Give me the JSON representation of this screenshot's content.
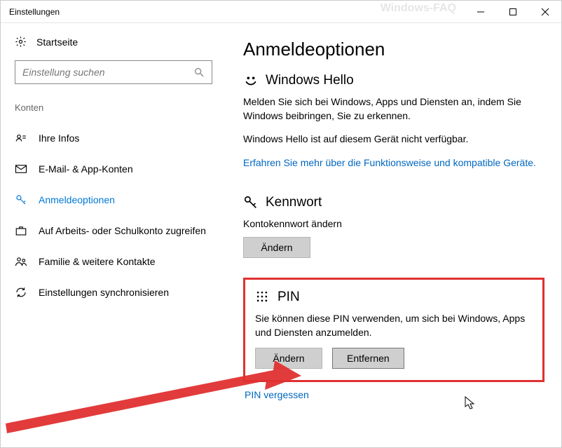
{
  "window": {
    "title": "Einstellungen",
    "watermark": "Windows-FAQ"
  },
  "sidebar": {
    "home_label": "Startseite",
    "search_placeholder": "Einstellung suchen",
    "section_label": "Konten",
    "items": [
      {
        "label": "Ihre Infos"
      },
      {
        "label": "E-Mail- & App-Konten"
      },
      {
        "label": "Anmeldeoptionen"
      },
      {
        "label": "Auf Arbeits- oder Schulkonto zugreifen"
      },
      {
        "label": "Familie & weitere Kontakte"
      },
      {
        "label": "Einstellungen synchronisieren"
      }
    ]
  },
  "main": {
    "title": "Anmeldeoptionen",
    "hello": {
      "heading": "Windows Hello",
      "desc": "Melden Sie sich bei Windows, Apps und Diensten an, indem Sie Windows beibringen, Sie zu erkennen.",
      "unavailable": "Windows Hello ist auf diesem Gerät nicht verfügbar.",
      "learn_link": "Erfahren Sie mehr über die Funktionsweise und kompatible Geräte."
    },
    "password": {
      "heading": "Kennwort",
      "desc": "Kontokennwort ändern",
      "change_btn": "Ändern"
    },
    "pin": {
      "heading": "PIN",
      "desc": "Sie können diese PIN verwenden, um sich bei Windows, Apps und Diensten anzumelden.",
      "change_btn": "Ändern",
      "remove_btn": "Entfernen",
      "forgot": "PIN vergessen"
    }
  }
}
